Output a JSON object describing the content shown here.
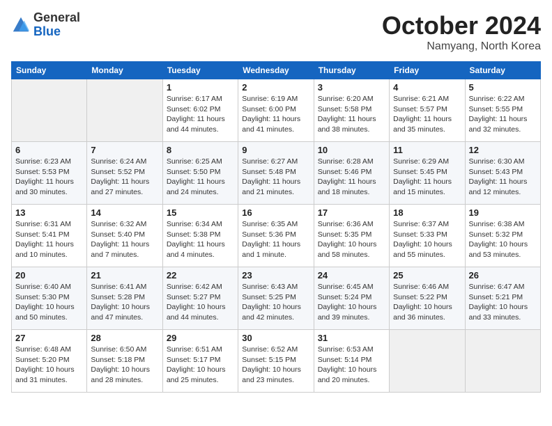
{
  "header": {
    "logo_general": "General",
    "logo_blue": "Blue",
    "month_title": "October 2024",
    "location": "Namyang, North Korea"
  },
  "days_of_week": [
    "Sunday",
    "Monday",
    "Tuesday",
    "Wednesday",
    "Thursday",
    "Friday",
    "Saturday"
  ],
  "weeks": [
    [
      {
        "day": "",
        "empty": true
      },
      {
        "day": "",
        "empty": true
      },
      {
        "day": "1",
        "sunrise": "Sunrise: 6:17 AM",
        "sunset": "Sunset: 6:02 PM",
        "daylight": "Daylight: 11 hours and 44 minutes."
      },
      {
        "day": "2",
        "sunrise": "Sunrise: 6:19 AM",
        "sunset": "Sunset: 6:00 PM",
        "daylight": "Daylight: 11 hours and 41 minutes."
      },
      {
        "day": "3",
        "sunrise": "Sunrise: 6:20 AM",
        "sunset": "Sunset: 5:58 PM",
        "daylight": "Daylight: 11 hours and 38 minutes."
      },
      {
        "day": "4",
        "sunrise": "Sunrise: 6:21 AM",
        "sunset": "Sunset: 5:57 PM",
        "daylight": "Daylight: 11 hours and 35 minutes."
      },
      {
        "day": "5",
        "sunrise": "Sunrise: 6:22 AM",
        "sunset": "Sunset: 5:55 PM",
        "daylight": "Daylight: 11 hours and 32 minutes."
      }
    ],
    [
      {
        "day": "6",
        "sunrise": "Sunrise: 6:23 AM",
        "sunset": "Sunset: 5:53 PM",
        "daylight": "Daylight: 11 hours and 30 minutes."
      },
      {
        "day": "7",
        "sunrise": "Sunrise: 6:24 AM",
        "sunset": "Sunset: 5:52 PM",
        "daylight": "Daylight: 11 hours and 27 minutes."
      },
      {
        "day": "8",
        "sunrise": "Sunrise: 6:25 AM",
        "sunset": "Sunset: 5:50 PM",
        "daylight": "Daylight: 11 hours and 24 minutes."
      },
      {
        "day": "9",
        "sunrise": "Sunrise: 6:27 AM",
        "sunset": "Sunset: 5:48 PM",
        "daylight": "Daylight: 11 hours and 21 minutes."
      },
      {
        "day": "10",
        "sunrise": "Sunrise: 6:28 AM",
        "sunset": "Sunset: 5:46 PM",
        "daylight": "Daylight: 11 hours and 18 minutes."
      },
      {
        "day": "11",
        "sunrise": "Sunrise: 6:29 AM",
        "sunset": "Sunset: 5:45 PM",
        "daylight": "Daylight: 11 hours and 15 minutes."
      },
      {
        "day": "12",
        "sunrise": "Sunrise: 6:30 AM",
        "sunset": "Sunset: 5:43 PM",
        "daylight": "Daylight: 11 hours and 12 minutes."
      }
    ],
    [
      {
        "day": "13",
        "sunrise": "Sunrise: 6:31 AM",
        "sunset": "Sunset: 5:41 PM",
        "daylight": "Daylight: 11 hours and 10 minutes."
      },
      {
        "day": "14",
        "sunrise": "Sunrise: 6:32 AM",
        "sunset": "Sunset: 5:40 PM",
        "daylight": "Daylight: 11 hours and 7 minutes."
      },
      {
        "day": "15",
        "sunrise": "Sunrise: 6:34 AM",
        "sunset": "Sunset: 5:38 PM",
        "daylight": "Daylight: 11 hours and 4 minutes."
      },
      {
        "day": "16",
        "sunrise": "Sunrise: 6:35 AM",
        "sunset": "Sunset: 5:36 PM",
        "daylight": "Daylight: 11 hours and 1 minute."
      },
      {
        "day": "17",
        "sunrise": "Sunrise: 6:36 AM",
        "sunset": "Sunset: 5:35 PM",
        "daylight": "Daylight: 10 hours and 58 minutes."
      },
      {
        "day": "18",
        "sunrise": "Sunrise: 6:37 AM",
        "sunset": "Sunset: 5:33 PM",
        "daylight": "Daylight: 10 hours and 55 minutes."
      },
      {
        "day": "19",
        "sunrise": "Sunrise: 6:38 AM",
        "sunset": "Sunset: 5:32 PM",
        "daylight": "Daylight: 10 hours and 53 minutes."
      }
    ],
    [
      {
        "day": "20",
        "sunrise": "Sunrise: 6:40 AM",
        "sunset": "Sunset: 5:30 PM",
        "daylight": "Daylight: 10 hours and 50 minutes."
      },
      {
        "day": "21",
        "sunrise": "Sunrise: 6:41 AM",
        "sunset": "Sunset: 5:28 PM",
        "daylight": "Daylight: 10 hours and 47 minutes."
      },
      {
        "day": "22",
        "sunrise": "Sunrise: 6:42 AM",
        "sunset": "Sunset: 5:27 PM",
        "daylight": "Daylight: 10 hours and 44 minutes."
      },
      {
        "day": "23",
        "sunrise": "Sunrise: 6:43 AM",
        "sunset": "Sunset: 5:25 PM",
        "daylight": "Daylight: 10 hours and 42 minutes."
      },
      {
        "day": "24",
        "sunrise": "Sunrise: 6:45 AM",
        "sunset": "Sunset: 5:24 PM",
        "daylight": "Daylight: 10 hours and 39 minutes."
      },
      {
        "day": "25",
        "sunrise": "Sunrise: 6:46 AM",
        "sunset": "Sunset: 5:22 PM",
        "daylight": "Daylight: 10 hours and 36 minutes."
      },
      {
        "day": "26",
        "sunrise": "Sunrise: 6:47 AM",
        "sunset": "Sunset: 5:21 PM",
        "daylight": "Daylight: 10 hours and 33 minutes."
      }
    ],
    [
      {
        "day": "27",
        "sunrise": "Sunrise: 6:48 AM",
        "sunset": "Sunset: 5:20 PM",
        "daylight": "Daylight: 10 hours and 31 minutes."
      },
      {
        "day": "28",
        "sunrise": "Sunrise: 6:50 AM",
        "sunset": "Sunset: 5:18 PM",
        "daylight": "Daylight: 10 hours and 28 minutes."
      },
      {
        "day": "29",
        "sunrise": "Sunrise: 6:51 AM",
        "sunset": "Sunset: 5:17 PM",
        "daylight": "Daylight: 10 hours and 25 minutes."
      },
      {
        "day": "30",
        "sunrise": "Sunrise: 6:52 AM",
        "sunset": "Sunset: 5:15 PM",
        "daylight": "Daylight: 10 hours and 23 minutes."
      },
      {
        "day": "31",
        "sunrise": "Sunrise: 6:53 AM",
        "sunset": "Sunset: 5:14 PM",
        "daylight": "Daylight: 10 hours and 20 minutes."
      },
      {
        "day": "",
        "empty": true
      },
      {
        "day": "",
        "empty": true
      }
    ]
  ]
}
